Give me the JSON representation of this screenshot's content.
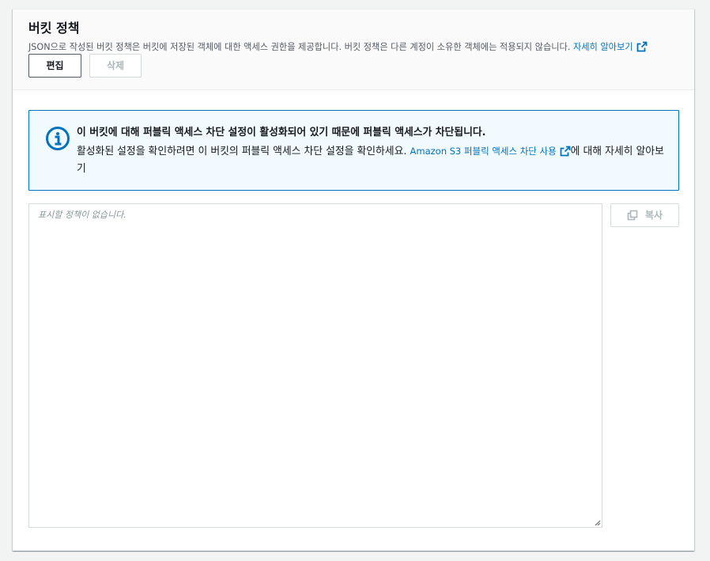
{
  "section": {
    "title": "버킷 정책",
    "description": "JSON으로 작성된 버킷 정책은 버킷에 저장된 객체에 대한 액세스 권한을 제공합니다. 버킷 정책은 다른 계정이 소유한 객체에는 적용되지 않습니다.",
    "learn_more_link": "자세히 알아보기",
    "external_icon": "external-link-icon"
  },
  "actions": {
    "edit_label": "편집",
    "delete_label": "삭제"
  },
  "alert": {
    "icon": "info-icon",
    "title": "이 버킷에 대해 퍼블릭 액세스 차단 설정이 활성화되어 있기 때문에 퍼블릭 액세스가 차단됩니다.",
    "body_prefix": "활성화된 설정을 확인하려면 이 버킷의 퍼블릭 액세스 차단 설정을 확인하세요.",
    "link_text": "Amazon S3 퍼블릭 액세스 차단 사용",
    "body_suffix": "에 대해 자세히 알아보기"
  },
  "policy_editor": {
    "placeholder": "표시할 정책이 없습니다."
  },
  "copy_button": {
    "label": "복사",
    "icon": "copy-icon"
  },
  "colors": {
    "link": "#0073bb",
    "alert_bg": "#f1faff",
    "alert_border": "#0073bb",
    "disabled_text": "#aab7b8"
  }
}
